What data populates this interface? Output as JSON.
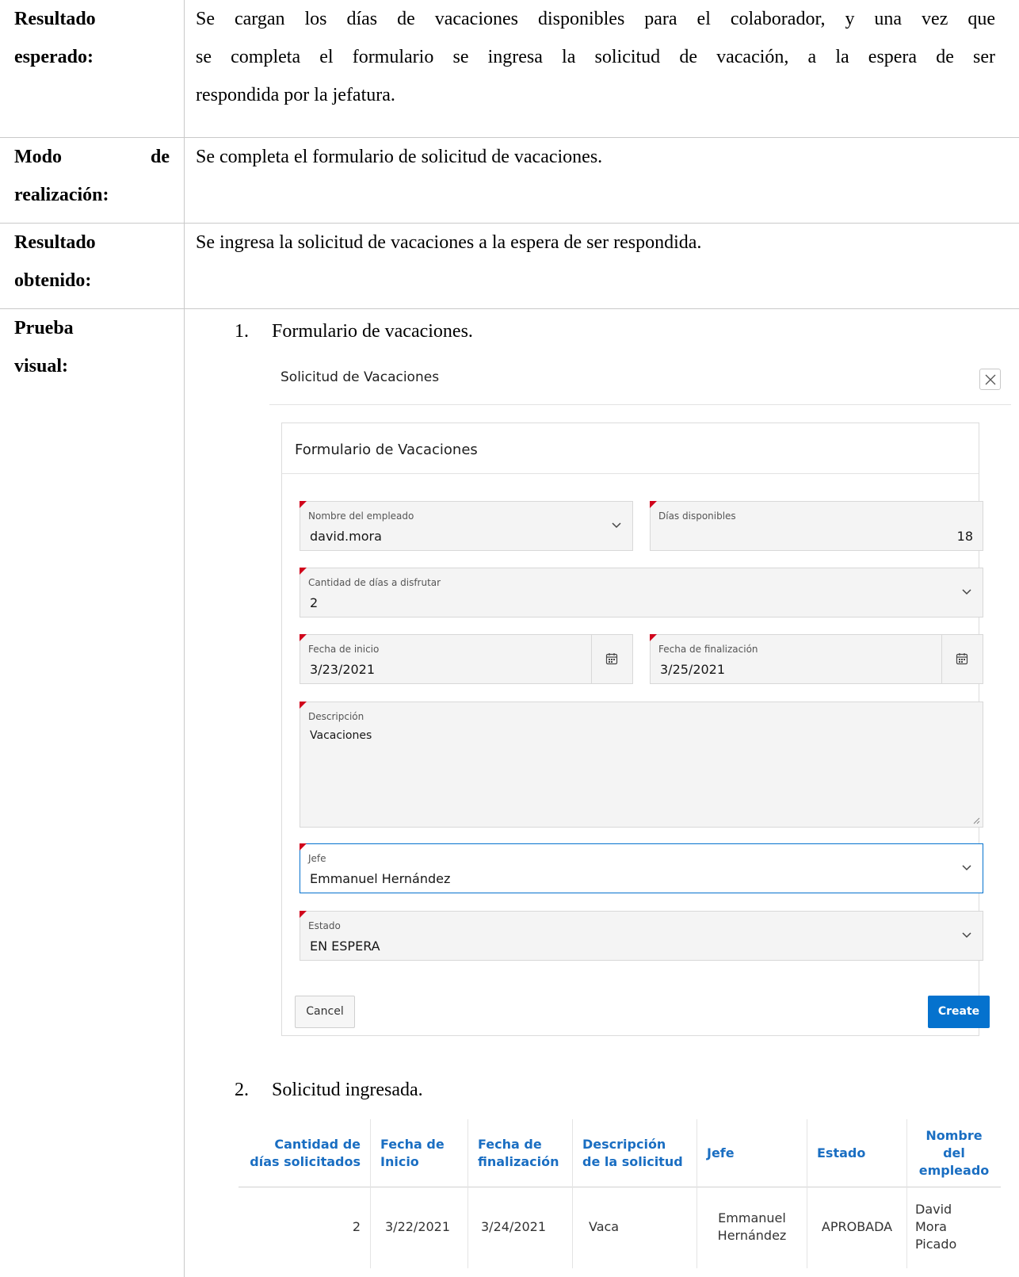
{
  "rows": {
    "expected": {
      "label_line1": "Resultado",
      "label_line2": "esperado:",
      "text_line1": "Se cargan los días de vacaciones disponibles para el colaborador, y una vez que",
      "text_line2": "se completa el formulario se ingresa la solicitud de vacación, a la espera de ser",
      "text_line3": "respondida por la jefatura."
    },
    "mode": {
      "label_line1": "Modo de",
      "label_line2": "realización:",
      "text": "Se completa el formulario de solicitud de vacaciones."
    },
    "obtained": {
      "label_line1": "Resultado",
      "label_line2": "obtenido:",
      "text": "Se ingresa la solicitud de vacaciones a la espera de ser respondida."
    },
    "visual": {
      "label_line1": "Prueba",
      "label_line2": "visual:",
      "item1_num": "1.",
      "item1_text": "Formulario de vacaciones.",
      "item2_num": "2.",
      "item2_text": "Solicitud ingresada."
    }
  },
  "modal": {
    "title": "Solicitud de Vacaciones",
    "card_title": "Formulario de Vacaciones",
    "fields": {
      "employee": {
        "label": "Nombre del empleado",
        "value": "david.mora"
      },
      "available_days": {
        "label": "Días disponibles",
        "value": "18"
      },
      "days_to_enjoy": {
        "label": "Cantidad de días a disfrutar",
        "value": "2"
      },
      "start_date": {
        "label": "Fecha de inicio",
        "value": "3/23/2021"
      },
      "end_date": {
        "label": "Fecha de finalización",
        "value": "3/25/2021"
      },
      "description": {
        "label": "Descripción",
        "value": "Vacaciones"
      },
      "boss": {
        "label": "Jefe",
        "value": "Emmanuel Hernández"
      },
      "status": {
        "label": "Estado",
        "value": "EN ESPERA"
      }
    },
    "cancel_label": "Cancel",
    "create_label": "Create",
    "accent_color": "#0572ce",
    "required_marker_color": "#d0021b"
  },
  "table": {
    "headers": [
      "Cantidad de días solicitados",
      "Fecha de Inicio",
      "Fecha de finalización",
      "Descripción de la solicitud",
      "Jefe",
      "Estado",
      "Nombre del empleado"
    ],
    "row": [
      "2",
      "3/22/2021",
      "3/24/2021",
      "Vaca",
      "Emmanuel Hernández",
      "APROBADA",
      "David Mora Picado"
    ],
    "header_color": "#1a6ec2"
  },
  "icons": [
    "close-icon",
    "chevron-down-icon",
    "calendar-icon",
    "resize-handle-icon"
  ]
}
